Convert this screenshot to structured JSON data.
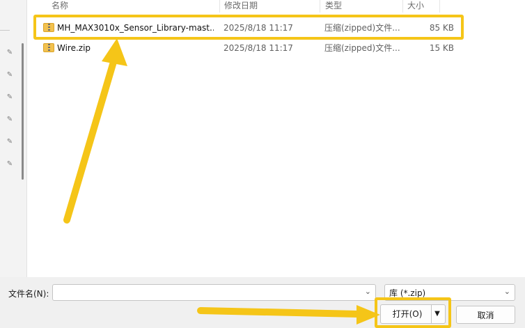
{
  "columns": {
    "name": "名称",
    "date": "修改日期",
    "type": "类型",
    "size": "大小"
  },
  "files": [
    {
      "name": "MH_MAX3010x_Sensor_Library-mast...",
      "date": "2025/8/18 11:17",
      "type": "压缩(zipped)文件...",
      "size": "85 KB",
      "icon": "zip-folder-icon"
    },
    {
      "name": "Wire.zip",
      "date": "2025/8/18 11:17",
      "type": "压缩(zipped)文件...",
      "size": "15 KB",
      "icon": "zip-folder-icon"
    }
  ],
  "filename_label": "文件名(N):",
  "filename_value": "",
  "filetype_value": "库 (*.zip)",
  "open_label": "打开(O)",
  "cancel_label": "取消",
  "annotation_color": "#f5c518"
}
